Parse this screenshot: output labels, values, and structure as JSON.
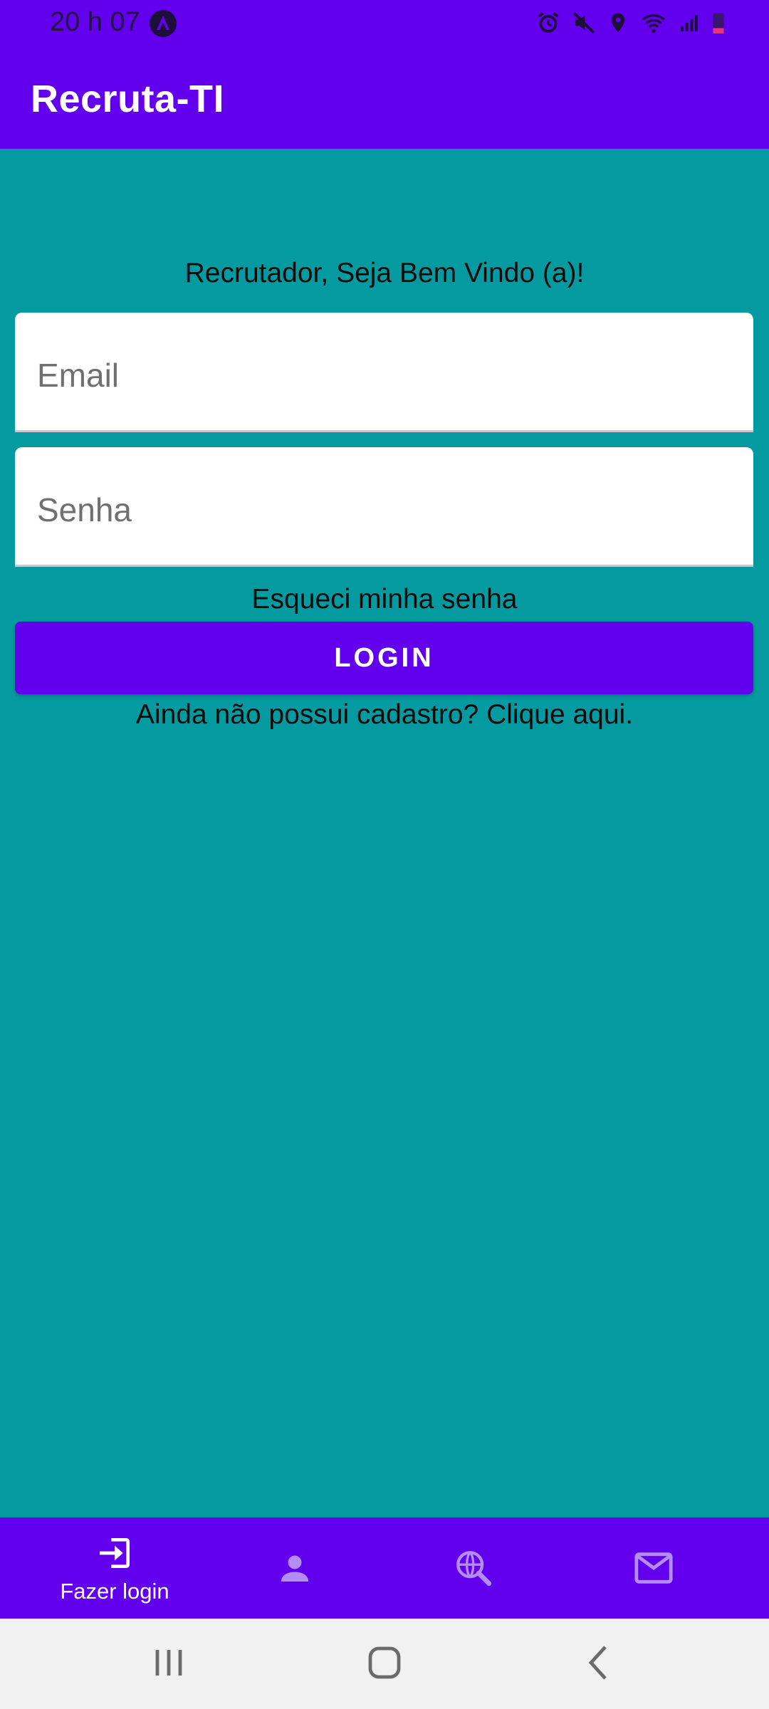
{
  "status_bar": {
    "time": "20 h 07"
  },
  "app_bar": {
    "title": "Recruta-TI"
  },
  "login_form": {
    "welcome": "Recrutador, Seja Bem Vindo (a)!",
    "email_placeholder": "Email",
    "password_placeholder": "Senha",
    "forgot_password": "Esqueci minha senha",
    "login_button": "LOGIN",
    "signup_prompt": "Ainda não possui cadastro? Clique aqui."
  },
  "bottom_nav": {
    "items": [
      {
        "label": "Fazer login",
        "icon": "login-icon",
        "active": true
      },
      {
        "label": "",
        "icon": "person-icon",
        "active": false
      },
      {
        "label": "",
        "icon": "globe-search-icon",
        "active": false
      },
      {
        "label": "",
        "icon": "mail-icon",
        "active": false
      }
    ]
  },
  "colors": {
    "primary": "#6200ee",
    "background": "#049a9f",
    "field_background": "#ffffff",
    "system_nav": "#f1f1f1"
  }
}
